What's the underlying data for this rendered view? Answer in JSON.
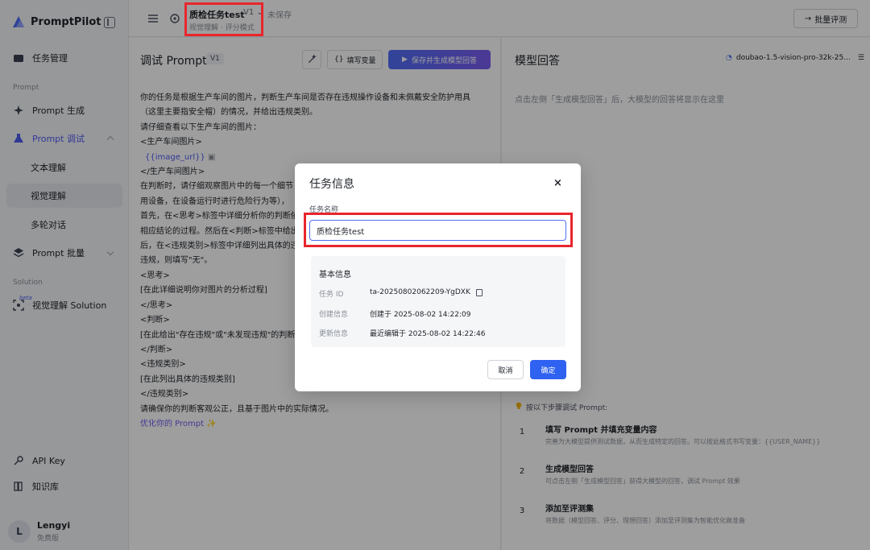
{
  "app": {
    "name": "PromptPilot"
  },
  "sidebar": {
    "task_mgmt": "任务管理",
    "section_prompt": "Prompt",
    "prompt_gen": "Prompt 生成",
    "prompt_debug": "Prompt 调试",
    "text_understanding": "文本理解",
    "visual_understanding": "视觉理解",
    "multi_turn": "多轮对话",
    "prompt_batch": "Prompt 批量",
    "section_solution": "Solution",
    "beta": "beta",
    "visual_solution": "视觉理解 Solution",
    "api_key": "API Key",
    "knowledge": "知识库",
    "user_name": "Lengyi",
    "user_initial": "L",
    "user_plan": "免费版"
  },
  "topbar": {
    "task_title": "质检任务test",
    "version": "V1",
    "unsaved": "未保存",
    "subtitle": "视觉理解 · 评分模式",
    "batch_eval": "批量评测"
  },
  "editor": {
    "title": "调试 Prompt",
    "version": "V1",
    "fill_vars": "填写变量",
    "save_generate": "保存并生成模型回答",
    "lines": [
      "你的任务是根据生产车间的图片，判断生产车间是否存在违规操作设备和未佩戴安全防护用具",
      "（这里主要指安全帽）的情况，并给出违规类别。",
      "请仔细查看以下生产车间的图片：",
      "<生产车间图片>",
      "{{image_url}}",
      "</生产车间图片>",
      "在判断时，请仔细观察图片中的每一个细节",
      "用设备，在设备运行时进行危险行为等），",
      "首先，在<思考>标签中详细分析你的判断依",
      "相应结论的过程。然后在<判断>标签中给出",
      "后，在<违规类别>标签中详细列出具体的违",
      "违规，则填写\"无\"。",
      "<思考>",
      "[在此详细说明你对图片的分析过程]",
      "</思考>",
      "<判断>",
      "[在此给出\"存在违规\"或\"未发现违规\"的判断",
      "</判断>",
      "<违规类别>",
      "[在此列出具体的违规类别]",
      "</违规类别>",
      "请确保你的判断客观公正，且基于图片中的实际情况。"
    ],
    "optimize": "优化你的 Prompt ✨"
  },
  "response": {
    "title": "模型回答",
    "model": "doubao-1.5-vision-pro-32k-25...",
    "hint": "点击左侧「生成模型回答」后，大模型的回答将显示在这里",
    "steps_head": "按以下步骤调试 Prompt:",
    "steps": [
      {
        "num": "1",
        "title": "填写 Prompt 并填充变量内容",
        "desc": "完善为大模型提供测试数据，从而生成特定的回答。可以按此格式书写变量：{{USER_NAME}}"
      },
      {
        "num": "2",
        "title": "生成模型回答",
        "desc": "可点击左侧「生成模型回答」获得大模型的回答，调试 Prompt 效果"
      },
      {
        "num": "3",
        "title": "添加至评测集",
        "desc": "将数据（模型回答、评分、理想回答）添加至评测集为智能优化做准备"
      }
    ]
  },
  "modal": {
    "title": "任务信息",
    "close": "×",
    "field_label": "任务名称",
    "name_value": "质检任务test",
    "info_title": "基本信息",
    "rows": [
      {
        "key": "任务 ID",
        "value": "ta-20250802062209-YgDXK"
      },
      {
        "key": "创建信息",
        "value": "创建于 2025-08-02 14:22:09"
      },
      {
        "key": "更新信息",
        "value": "最近编辑于 2025-08-02 14:22:46"
      }
    ],
    "cancel": "取消",
    "confirm": "确定"
  }
}
